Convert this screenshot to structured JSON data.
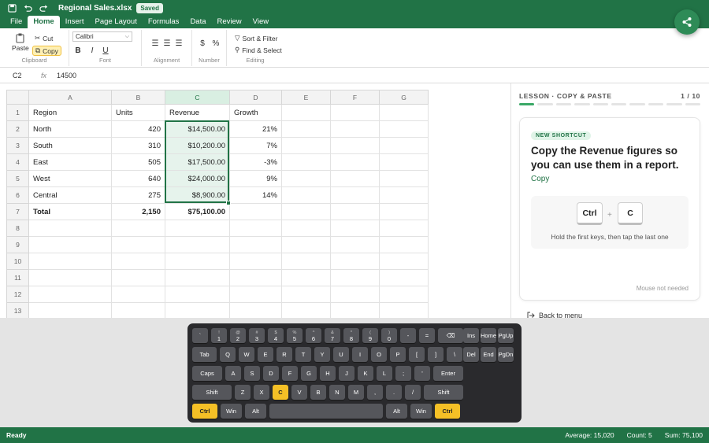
{
  "app": {
    "title": "Regional Sales.xlsx",
    "saved": "Saved"
  },
  "tabs": [
    "File",
    "Home",
    "Insert",
    "Page Layout",
    "Formulas",
    "Data",
    "Review",
    "View"
  ],
  "ribbon": {
    "clipboard": {
      "paste": "Paste",
      "cut": "Cut",
      "copy": "Copy",
      "label": "Clipboard"
    },
    "font": {
      "name": "Calibri",
      "bold": "B",
      "italic": "I",
      "underline": "U",
      "label": "Font"
    },
    "alignment": {
      "label": "Alignment"
    },
    "number": {
      "currency": "$",
      "percent": "%",
      "label": "Number"
    },
    "editing": {
      "sort": "Sort & Filter",
      "find": "Find & Select",
      "label": "Editing"
    }
  },
  "formula_bar": {
    "cell_ref": "C2",
    "fx": "fx",
    "value": "14500"
  },
  "sheet": {
    "columns": [
      "A",
      "B",
      "C",
      "D",
      "E",
      "F",
      "G"
    ],
    "row_numbers": [
      "1",
      "2",
      "3",
      "4",
      "5",
      "6",
      "7",
      "8",
      "9",
      "10",
      "11",
      "12",
      "13"
    ],
    "rows": [
      [
        "Region",
        "Units",
        "Revenue",
        "Growth",
        "",
        "",
        ""
      ],
      [
        "North",
        "420",
        "$14,500.00",
        "21%",
        "",
        "",
        ""
      ],
      [
        "South",
        "310",
        "$10,200.00",
        "7%",
        "",
        "",
        ""
      ],
      [
        "East",
        "505",
        "$17,500.00",
        "-3%",
        "",
        "",
        ""
      ],
      [
        "West",
        "640",
        "$24,000.00",
        "9%",
        "",
        "",
        ""
      ],
      [
        "Central",
        "275",
        "$8,900.00",
        "14%",
        "",
        "",
        ""
      ],
      [
        "Total",
        "2,150",
        "$75,100.00",
        "",
        "",
        "",
        ""
      ],
      [
        "",
        "",
        "",
        "",
        "",
        "",
        ""
      ],
      [
        "",
        "",
        "",
        "",
        "",
        "",
        ""
      ],
      [
        "",
        "",
        "",
        "",
        "",
        "",
        ""
      ],
      [
        "",
        "",
        "",
        "",
        "",
        "",
        ""
      ],
      [
        "",
        "",
        "",
        "",
        "",
        "",
        ""
      ],
      [
        "",
        "",
        "",
        "",
        "",
        "",
        ""
      ]
    ]
  },
  "lesson": {
    "header": "LESSON · COPY & PASTE",
    "progress_text": "1 / 10",
    "progress": {
      "current": 1,
      "total": 10
    },
    "badge": "NEW SHORTCUT",
    "instruction": "Copy the Revenue figures so you can use them in a report.",
    "command": "Copy",
    "keys": [
      "Ctrl",
      "C"
    ],
    "plus": "+",
    "hint": "Hold the first keys, then tap the last one",
    "mouse_note": "Mouse not needed",
    "back": "Back to menu"
  },
  "keyboard": {
    "rows": [
      [
        [
          "`",
          ""
        ],
        [
          "1",
          "!"
        ],
        [
          "2",
          "@"
        ],
        [
          "3",
          "#"
        ],
        [
          "4",
          "$"
        ],
        [
          "5",
          "%"
        ],
        [
          "6",
          "^"
        ],
        [
          "7",
          "&"
        ],
        [
          "8",
          "*"
        ],
        [
          "9",
          "("
        ],
        [
          "0",
          ")"
        ],
        [
          "-",
          ""
        ],
        [
          "=",
          ""
        ],
        [
          "⌫",
          ""
        ]
      ],
      [
        [
          "Tab",
          ""
        ],
        [
          "Q",
          ""
        ],
        [
          "W",
          ""
        ],
        [
          "E",
          ""
        ],
        [
          "R",
          ""
        ],
        [
          "T",
          ""
        ],
        [
          "Y",
          ""
        ],
        [
          "U",
          ""
        ],
        [
          "I",
          ""
        ],
        [
          "O",
          ""
        ],
        [
          "P",
          ""
        ],
        [
          "[",
          ""
        ],
        [
          "]",
          ""
        ],
        [
          "\\",
          ""
        ]
      ],
      [
        [
          "Caps",
          ""
        ],
        [
          "A",
          ""
        ],
        [
          "S",
          ""
        ],
        [
          "D",
          ""
        ],
        [
          "F",
          ""
        ],
        [
          "G",
          ""
        ],
        [
          "H",
          ""
        ],
        [
          "J",
          ""
        ],
        [
          "K",
          ""
        ],
        [
          "L",
          ""
        ],
        [
          ";",
          ""
        ],
        [
          "'",
          ""
        ],
        [
          "Enter",
          ""
        ]
      ],
      [
        [
          "Shift",
          ""
        ],
        [
          "Z",
          ""
        ],
        [
          "X",
          ""
        ],
        [
          "C",
          ""
        ],
        [
          "V",
          ""
        ],
        [
          "B",
          ""
        ],
        [
          "N",
          ""
        ],
        [
          "M",
          ""
        ],
        [
          ",",
          ""
        ],
        [
          ".",
          ""
        ],
        [
          "/",
          ""
        ],
        [
          "Shift",
          ""
        ]
      ],
      [
        [
          "Ctrl",
          ""
        ],
        [
          "Win",
          ""
        ],
        [
          "Alt",
          ""
        ],
        [
          "",
          ""
        ],
        [
          "Alt",
          ""
        ],
        [
          "Win",
          ""
        ],
        [
          "Ctrl",
          ""
        ]
      ]
    ],
    "nav": [
      [
        "Ins",
        "Home",
        "PgUp"
      ],
      [
        "Del",
        "End",
        "PgDn"
      ]
    ],
    "highlighted": [
      "Ctrl",
      "C"
    ]
  },
  "status": {
    "ready": "Ready",
    "average": "Average: 15,020",
    "count": "Count: 5",
    "sum": "Sum: 75,100"
  },
  "colors": {
    "accent": "#217346",
    "highlight_key": "#f5c026",
    "selection": "#e6f3ec"
  }
}
